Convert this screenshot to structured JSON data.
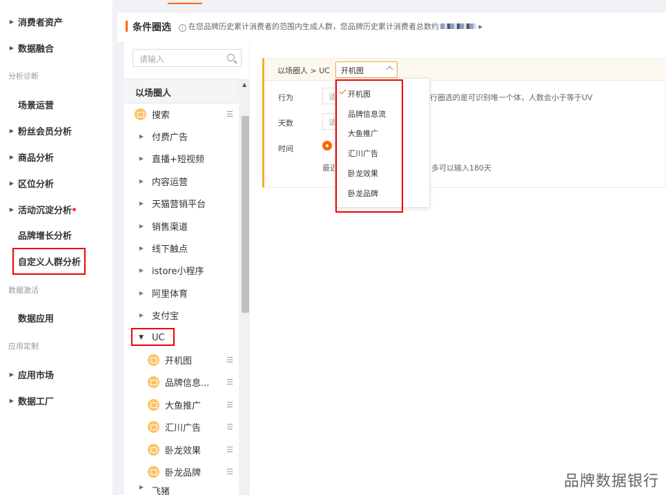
{
  "nav": {
    "items": [
      {
        "label": "消费者资产",
        "arrow": true
      },
      {
        "label": "数据融合",
        "arrow": true
      },
      {
        "label": "场景运营",
        "arrow": false
      },
      {
        "label": "粉丝会员分析",
        "arrow": true
      },
      {
        "label": "商品分析",
        "arrow": true
      },
      {
        "label": "区位分析",
        "arrow": true
      },
      {
        "label": "活动沉淀分析",
        "arrow": true
      },
      {
        "label": "品牌增长分析",
        "arrow": false
      },
      {
        "label": "自定义人群分析",
        "arrow": false
      },
      {
        "label": "数据应用",
        "arrow": false
      },
      {
        "label": "应用市场",
        "arrow": true
      },
      {
        "label": "数据工厂",
        "arrow": true
      }
    ],
    "sections": [
      "分析诊断",
      "数据激活",
      "应用定制"
    ]
  },
  "header": {
    "title": "条件圈选",
    "info": "在您品牌历史累计消费者的范围内生成人群，您品牌历史累计消费者总数约"
  },
  "tree": {
    "search_placeholder": "请输入",
    "head": "以场圈人",
    "nodes": [
      {
        "label": "搜索",
        "type": "icon"
      },
      {
        "label": "付费广告",
        "type": "collapsed"
      },
      {
        "label": "直播+短视频",
        "type": "collapsed"
      },
      {
        "label": "内容运营",
        "type": "collapsed"
      },
      {
        "label": "天猫营销平台",
        "type": "collapsed"
      },
      {
        "label": "销售渠道",
        "type": "collapsed"
      },
      {
        "label": "线下触点",
        "type": "collapsed"
      },
      {
        "label": "istore小程序",
        "type": "collapsed"
      },
      {
        "label": "阿里体育",
        "type": "collapsed"
      },
      {
        "label": "支付宝",
        "type": "collapsed"
      },
      {
        "label": "UC",
        "type": "expanded"
      },
      {
        "label": "开机图",
        "type": "child"
      },
      {
        "label": "品牌信息...",
        "type": "child"
      },
      {
        "label": "大鱼推广",
        "type": "child"
      },
      {
        "label": "汇川广告",
        "type": "child"
      },
      {
        "label": "卧龙效果",
        "type": "child"
      },
      {
        "label": "卧龙品牌",
        "type": "child"
      },
      {
        "label": "飞猪",
        "type": "collapsed"
      }
    ]
  },
  "panel": {
    "path": "以场圈人 > UC",
    "selected": "开机图",
    "labels": {
      "behavior": "行为",
      "days": "天数",
      "time": "时间"
    },
    "input_ph": "请",
    "hint_uv": "行圈选的是可识别唯一个体，人数会小于等于UV",
    "recent": "最近",
    "hint_days": "多可以输入180天"
  },
  "dropdown": {
    "options": [
      "开机图",
      "品牌信息流",
      "大鱼推广",
      "汇川广告",
      "卧龙效果",
      "卧龙品牌"
    ]
  },
  "watermark": "品牌数据银行",
  "colors": {
    "accent": "#ff6600",
    "highlight": "#e00000",
    "border_accent": "#f5b022"
  }
}
